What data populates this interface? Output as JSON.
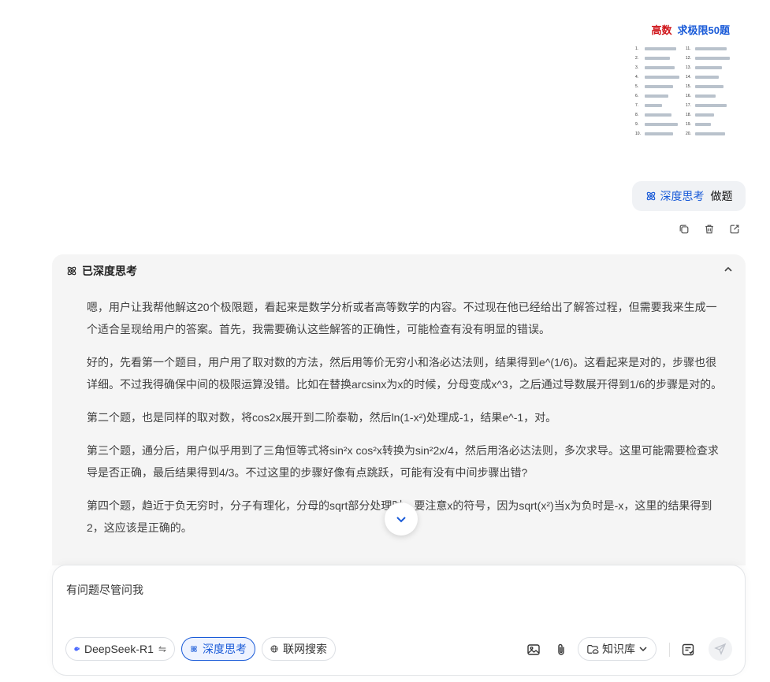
{
  "user_image": {
    "title_red": "高数",
    "title_blue": "求极限50题",
    "left_numbers": [
      "1.",
      "2.",
      "3.",
      "4.",
      "5.",
      "6.",
      "7.",
      "8.",
      "9.",
      "10."
    ],
    "right_numbers": [
      "11.",
      "12.",
      "13.",
      "14.",
      "15.",
      "16.",
      "17.",
      "18.",
      "19.",
      "20."
    ]
  },
  "user_message": {
    "deep_label": "深度思考",
    "text": "做题"
  },
  "think": {
    "header": "已深度思考",
    "paragraphs": [
      "嗯，用户让我帮他解这20个极限题，看起来是数学分析或者高等数学的内容。不过现在他已经给出了解答过程，但需要我来生成一个适合呈现给用户的答案。首先，我需要确认这些解答的正确性，可能检查有没有明显的错误。",
      "好的，先看第一个题目，用户用了取对数的方法，然后用等价无穷小和洛必达法则，结果得到e^(1/6)。这看起来是对的，步骤也很详细。不过我得确保中间的极限运算没错。比如在替换arcsinx为x的时候，分母变成x^3，之后通过导数展开得到1/6的步骤是对的。",
      "第二个题，也是同样的取对数，将cos2x展开到二阶泰勒，然后ln(1-x²)处理成-1，结果e^-1，对。",
      "第三个题，通分后，用户似乎用到了三角恒等式将sin²x cos²x转换为sin²2x/4，然后用洛必达法则，多次求导。这里可能需要检查求导是否正确，最后结果得到4/3。不过这里的步骤好像有点跳跃，可能有没有中间步骤出错?",
      "第四个题，趋近于负无穷时，分子有理化，分母的sqrt部分处理时，要注意x的符号，因为sqrt(x²)当x为负时是-x，这里的结果得到2，这应该是正确的。"
    ]
  },
  "input": {
    "placeholder": "有问题尽管问我",
    "model_label": "DeepSeek-R1",
    "deep_label": "深度思考",
    "web_label": "联网搜索",
    "kb_label": "知识库"
  },
  "colors": {
    "accent": "#1a5bd8",
    "title_red": "#d0171c",
    "panel_bg": "#f5f5f5"
  }
}
